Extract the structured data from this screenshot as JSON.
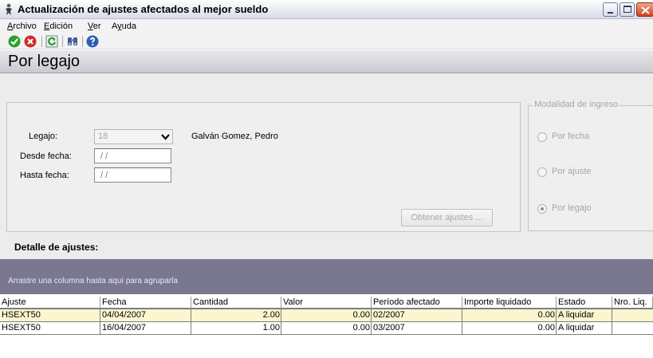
{
  "window": {
    "title": "Actualización de ajustes afectados al mejor sueldo",
    "controls": {
      "minimize_icon": "minimize-icon",
      "maximize_icon": "maximize-icon",
      "close_icon": "close-icon"
    }
  },
  "menu": {
    "items": [
      {
        "label": "Archivo",
        "mnemonic": "A"
      },
      {
        "label": "Edición",
        "mnemonic": "E"
      },
      {
        "label": "Ver",
        "mnemonic": "V"
      },
      {
        "label": "Ayuda",
        "mnemonic": "y"
      }
    ]
  },
  "toolbar": {
    "buttons": [
      "accept-icon",
      "cancel-icon",
      "refresh-icon",
      "binoculars-icon",
      "help-icon"
    ],
    "colors": {
      "accept": "#2aa12e",
      "cancel": "#d22b2b",
      "refresh": "#2a8d35",
      "help": "#2b5fb8"
    }
  },
  "section": {
    "title": "Por legajo"
  },
  "form": {
    "legajo_label": "Legajo:",
    "legajo_value": "18",
    "employee_name": "Galván Gomez, Pedro",
    "desde_label": "Desde fecha:",
    "desde_value": " / /",
    "hasta_label": "Hasta fecha:",
    "hasta_value": " / /",
    "get_button": "Obtener ajustes ..."
  },
  "modalidad": {
    "legend": "Modalidad de ingreso",
    "options": [
      {
        "label": "Por fecha",
        "selected": false
      },
      {
        "label": "Por ajuste",
        "selected": false
      },
      {
        "label": "Por legajo",
        "selected": true
      }
    ]
  },
  "detail": {
    "title": "Detalle de ajustes:",
    "group_hint": "Arrastre una columna hasta aquí para agruparla",
    "columns": [
      "Ajuste",
      "Fecha",
      "Cantidad",
      "Valor",
      "Período afectado",
      "Importe liquidado",
      "Estado",
      "Nro. Liq."
    ],
    "rows": [
      [
        "HSEXT50",
        "04/04/2007",
        "2.00",
        "0.00",
        "02/2007",
        "0.00",
        "A liquidar",
        ""
      ],
      [
        "HSEXT50",
        "16/04/2007",
        "1.00",
        "0.00",
        "03/2007",
        "0.00",
        "A liquidar",
        ""
      ]
    ]
  },
  "colors": {
    "group_band": "#7a7891",
    "selected_row": "#fbf6d0",
    "section_header": "#d9dae0"
  }
}
